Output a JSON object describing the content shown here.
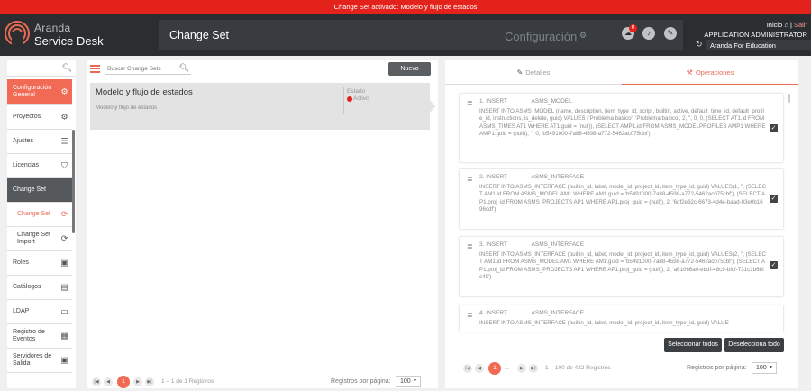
{
  "banner": "Change Set activado: Modelo y flujo de estados",
  "app": {
    "brand1": "Aranda",
    "brand2": "Service Desk"
  },
  "module": {
    "title": "Change Set",
    "config": "Configuración"
  },
  "notifications": {
    "count": "0"
  },
  "user": {
    "inicio": "Inicio",
    "salir": "Salir",
    "name": "APPLICATION ADMINISTRATOR",
    "org": "Aranda For Education"
  },
  "sidebar": {
    "items": [
      {
        "label": "Configuración General",
        "icon": "settings-gear-icon"
      },
      {
        "label": "Proyectos",
        "icon": "gear-icon"
      },
      {
        "label": "Ajustes",
        "icon": "sliders-icon"
      },
      {
        "label": "Licencias",
        "icon": "shield-icon"
      },
      {
        "label": "Change Set"
      },
      {
        "label": "Change Set",
        "icon": "refresh-icon"
      },
      {
        "label": "Change Set Import",
        "icon": "refresh-icon"
      },
      {
        "label": "Roles",
        "icon": "id-card-icon"
      },
      {
        "label": "Catálogos",
        "icon": "gallery-icon"
      },
      {
        "label": "LDAP",
        "icon": "folder-icon"
      },
      {
        "label": "Registro de Eventos",
        "icon": "calendar-icon"
      },
      {
        "label": "Servidores de Salida",
        "icon": "server-icon"
      }
    ]
  },
  "middle": {
    "search_placeholder": "Buscar Change Sets",
    "new_button": "Nuevo",
    "card": {
      "title": "Modelo y flujo de estados",
      "subtitle": "Modelo y flujo de estados",
      "state_label": "Estado",
      "state_value": "Activo"
    },
    "pager": {
      "page": "1",
      "info": "1 – 1 de 1 Registros",
      "rpp_label": "Registros por página:",
      "rpp": "100"
    }
  },
  "right": {
    "tabs": {
      "details": "Detalles",
      "operations": "Operaciones"
    },
    "operations": [
      {
        "head": "1. INSERT               ASMS_MODEL",
        "body": "INSERT INTO ASMS_MODEL (name, description, item_type_id, script, builtin, active, default_time_id, default_profile_id, instructions, is_delete, guid) VALUES ('Problema basico', 'Problema basico', 2, '', 0, 0, (SELECT AT1.id FROM ASMS_TIMES AT1 WHERE AT1.guid = (null)), (SELECT AMP1.id FROM ASMS_MODELPROFILES AMP1 WHERE AMP1.guid = (null)), '', 0, 'b5491000-7a88-4598-a772-5462ac075cbf')"
      },
      {
        "head": "2. INSERT               ASMS_INTERFACE",
        "body": "INSERT INTO ASMS_INTERFACE (builtin_id, label, model_id, project_id, item_type_id, guid) VALUES(1, '', (SELECT AM1.id FROM ASMS_MODEL AM1 WHERE AM1.guid = 'b5491000-7a88-4598-a772-5462ac075cbf'), (SELECT AP1.proj_id FROM ASMS_PROJECTS AP1 WHERE AP1.proj_guid = (null)), 2, '6df2e62c-6673-4d4e-baad-03e0b1696cdf')"
      },
      {
        "head": "3. INSERT               ASMS_INTERFACE",
        "body": "INSERT INTO ASMS_INTERFACE (builtin_id, label, model_id, project_id, item_type_id, guid) VALUES(2, '', (SELECT AM1.id FROM ASMS_MODEL AM1 WHERE AM1.guid = 'b5491000-7a88-4598-a772-5462ac075cbf'), (SELECT AP1.proj_id FROM ASMS_PROJECTS AP1 WHERE AP1.proj_guid = (null)), 2, 'a61066a0-ebdf-48c9-bfcf-731c1b68fc49')"
      },
      {
        "head": "4. INSERT               ASMS_INTERFACE",
        "body": "INSERT INTO ASMS_INTERFACE (builtin_id, label, model_id, project_id, item_type_id, guid) VALUE"
      }
    ],
    "select_all": "Seleccionar todos",
    "deselect_all": "Deselecciona todo",
    "pager": {
      "page": "1",
      "ellipsis": "...",
      "info": "1 – 100 de 422 Registros",
      "rpp_label": "Registros por página:",
      "rpp": "100"
    }
  }
}
